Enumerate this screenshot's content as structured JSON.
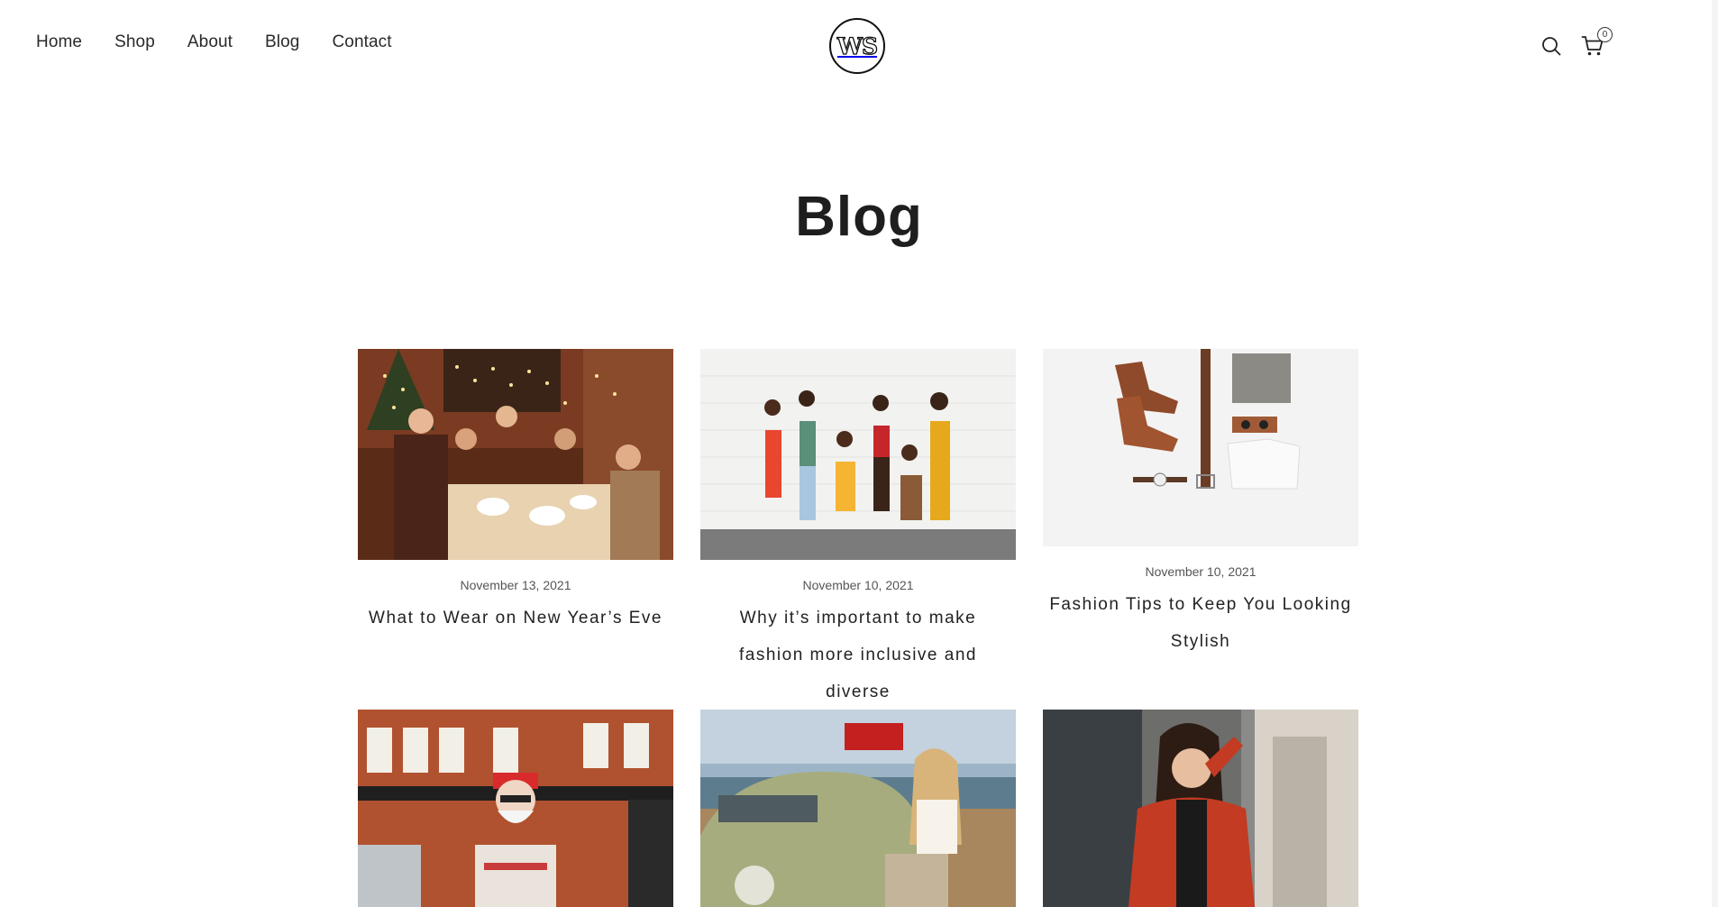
{
  "nav": {
    "items": [
      {
        "label": "Home"
      },
      {
        "label": "Shop"
      },
      {
        "label": "About"
      },
      {
        "label": "Blog"
      },
      {
        "label": "Contact"
      }
    ]
  },
  "logo": {
    "text": "WS"
  },
  "cart": {
    "count": "0"
  },
  "icons": {
    "search": "search-icon",
    "cart": "cart-icon"
  },
  "page": {
    "title": "Blog"
  },
  "posts": [
    {
      "date": "November 13, 2021",
      "title": "What to Wear on New Year’s Eve"
    },
    {
      "date": "November 10, 2021",
      "title": "Why it’s important to make fashion more inclusive and diverse"
    },
    {
      "date": "November 10, 2021",
      "title": "Fashion Tips to Keep You Looking Stylish"
    },
    {
      "date": "",
      "title": ""
    },
    {
      "date": "",
      "title": ""
    },
    {
      "date": "",
      "title": ""
    }
  ],
  "colors": {
    "text": "#222222",
    "background": "#ffffff",
    "muted": "#555555"
  }
}
